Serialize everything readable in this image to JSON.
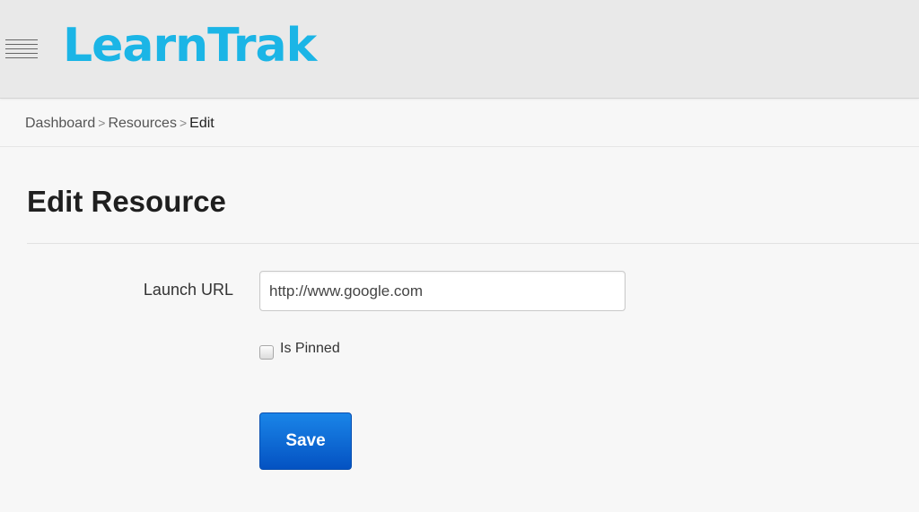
{
  "header": {
    "logo_text": "LearnTrak",
    "menu_icon": "hamburger-menu-icon"
  },
  "breadcrumb": {
    "items": [
      "Dashboard",
      "Resources",
      "Edit"
    ],
    "separator": ">"
  },
  "page": {
    "title": "Edit Resource"
  },
  "form": {
    "launch_url_label": "Launch URL",
    "launch_url_value": "http://www.google.com",
    "is_pinned_label": "Is Pinned",
    "is_pinned_checked": false,
    "save_label": "Save"
  },
  "colors": {
    "brand": "#1bb5e6",
    "button": "#0a63d6",
    "header_bg": "#e9e9e9",
    "page_bg": "#f7f7f7"
  }
}
